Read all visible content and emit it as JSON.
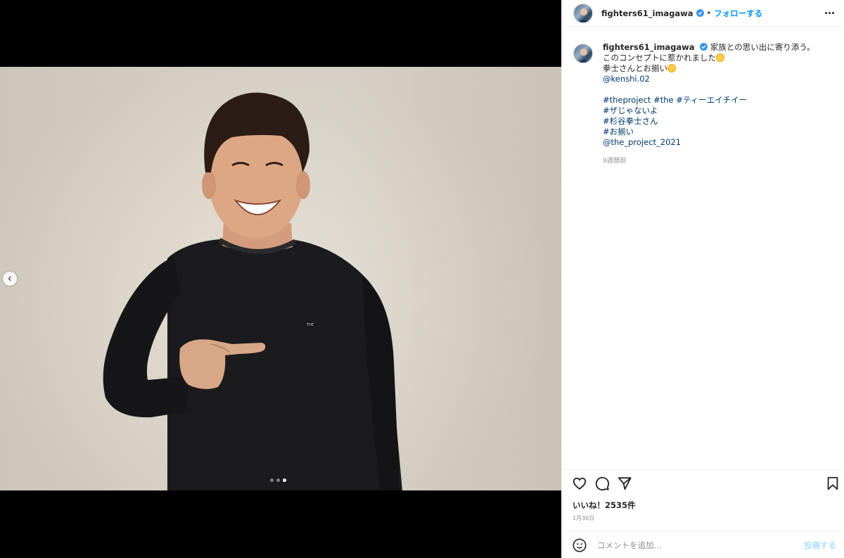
{
  "post": {
    "username": "fighters61_imagawa",
    "follow_label": "フォローする",
    "separator": "•",
    "caption": {
      "line1": "家族との思い出に寄り添う。",
      "line2": "このコンセプトに惹かれました",
      "line3": "拳士さんとお揃い",
      "mention1": "@kenshi.02",
      "hashtags1": "#theproject #the #ティーエイチイー",
      "hashtags2": "#ザじゃないよ",
      "hashtags3": "#杉谷拳士さん",
      "hashtags4": "#お揃い",
      "mention2": "@the_project_2021",
      "time_ago": "9週間前"
    },
    "likes_text": "いいね！2535件",
    "date": "1月30日",
    "comment_placeholder": "コメントを追加...",
    "post_label": "投稿する"
  },
  "media": {
    "shirt_logo_text": "THE",
    "carousel": {
      "total": 3,
      "active_index": 3
    }
  },
  "icons": {
    "header": [
      "avatar",
      "verified-badge-icon",
      "more-options-icon"
    ],
    "actions": [
      "heart-icon",
      "comment-icon",
      "share-icon",
      "bookmark-icon"
    ],
    "comment": [
      "emoji-icon"
    ],
    "media": [
      "chevron-left-icon"
    ]
  },
  "colors": {
    "link_blue": "#0095f6",
    "mention_navy": "#00376b",
    "muted": "#8e8e8e",
    "post_disabled": "#b2dffc"
  }
}
